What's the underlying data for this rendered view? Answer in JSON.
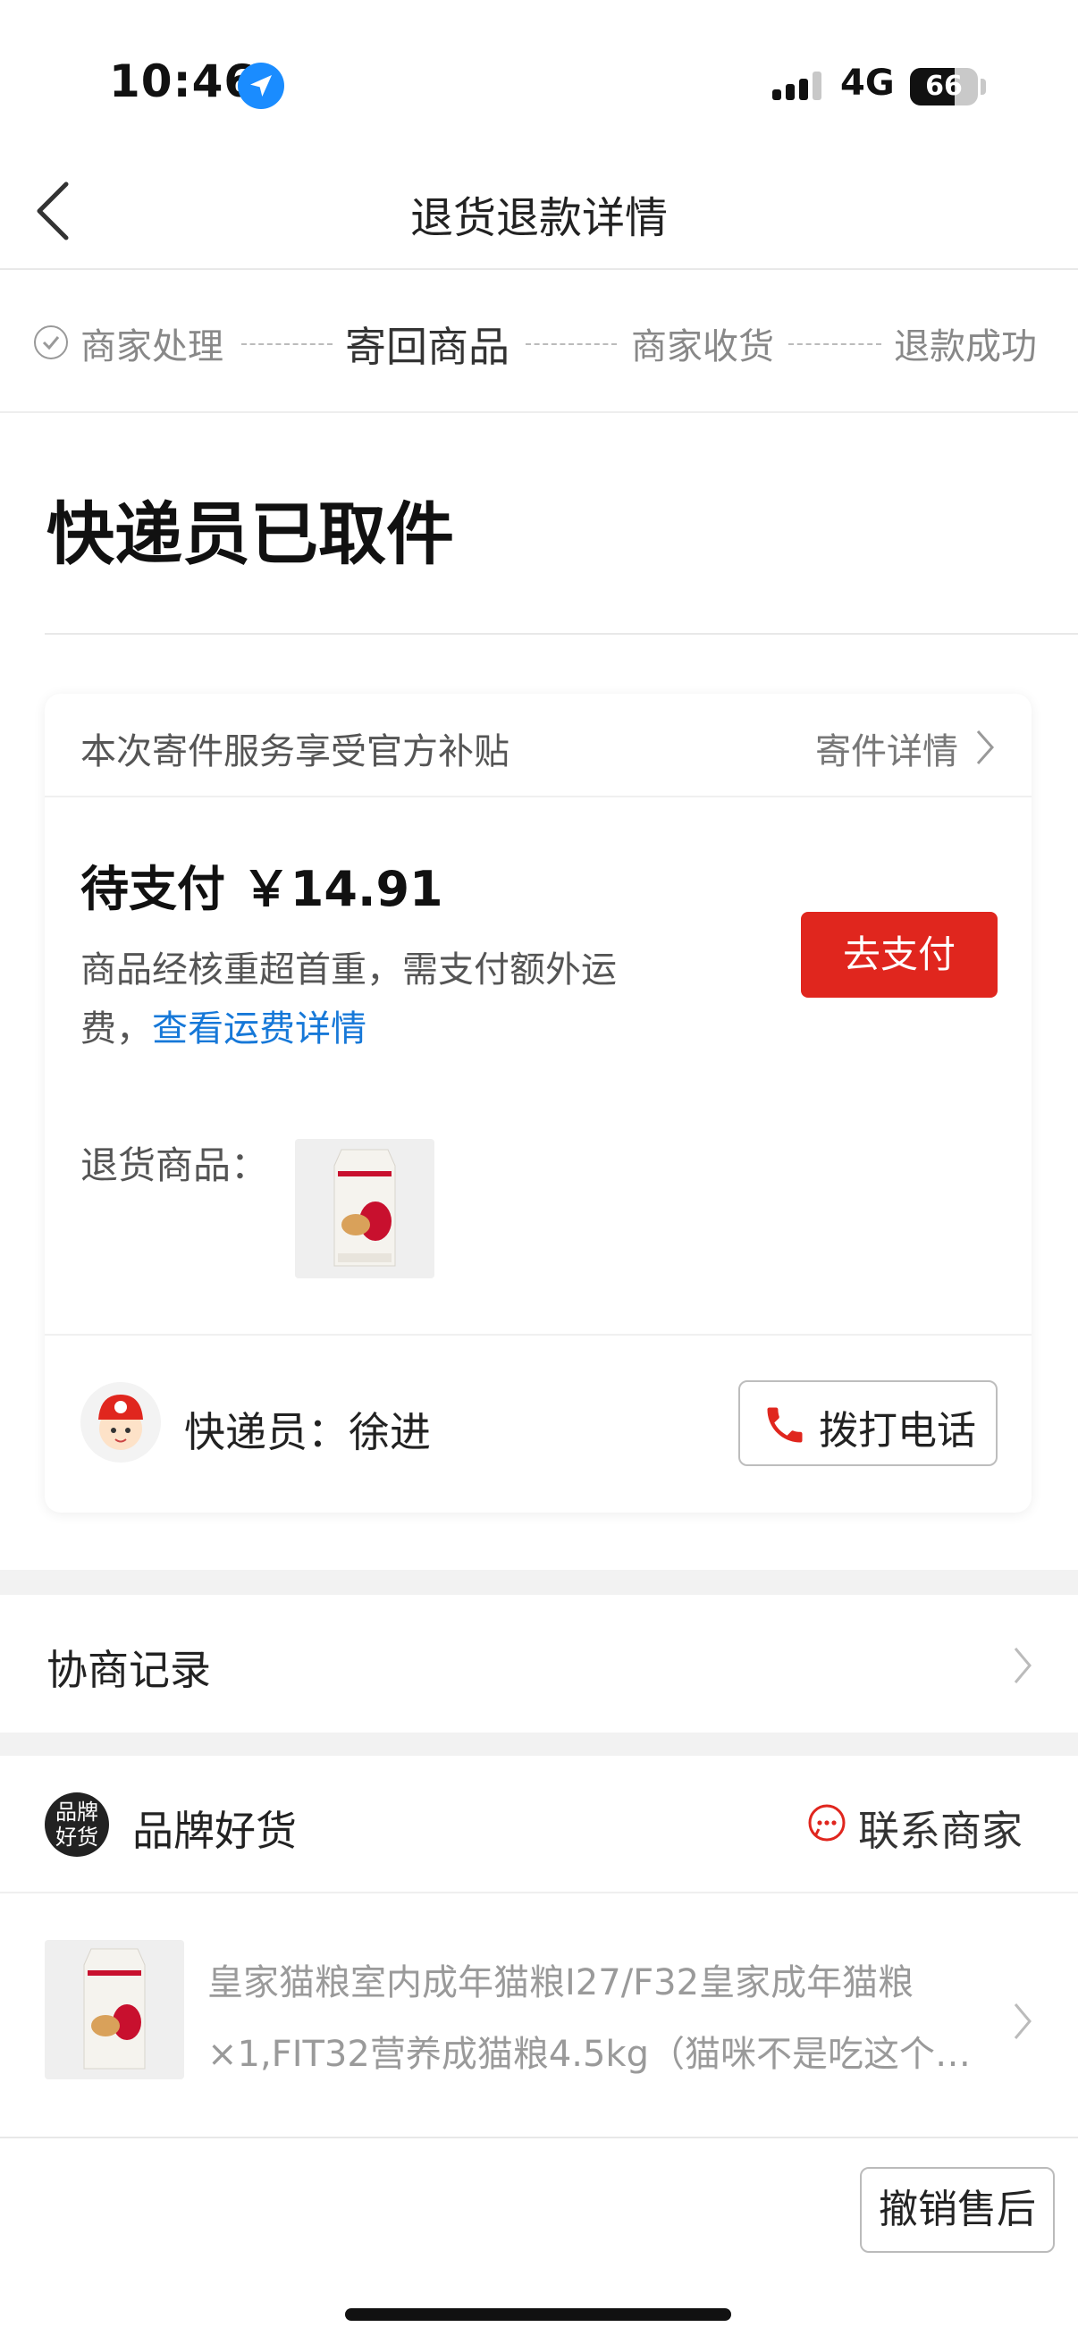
{
  "status_bar": {
    "time": "10:46",
    "network": "4G",
    "battery": "66"
  },
  "nav": {
    "title": "退货退款详情"
  },
  "steps": [
    {
      "label": "商家处理",
      "state": "done"
    },
    {
      "label": "寄回商品",
      "state": "active"
    },
    {
      "label": "商家收货",
      "state": "pending"
    },
    {
      "label": "退款成功",
      "state": "pending"
    }
  ],
  "status_title": "快递员已取件",
  "shipping_card": {
    "subsidy_text": "本次寄件服务享受官方补贴",
    "detail_link": "寄件详情",
    "pay_title": "待支付 ￥14.91",
    "pay_desc": "商品经核重超首重，需支付额外运费，",
    "pay_link": "查看运费详情",
    "pay_button": "去支付",
    "goods_label": "退货商品：",
    "courier_label": "快递员：徐进",
    "call_button": "拨打电话"
  },
  "negotiation": {
    "label": "协商记录"
  },
  "shop": {
    "badge": "品牌好货",
    "name": "品牌好货",
    "contact": "联系商家",
    "product_line1": "皇家猫粮室内成年猫粮I27/F32皇家成年猫粮",
    "product_line2": "×1,FIT32营养成猫粮4.5kg（猫咪不是吃这个…"
  },
  "footer": {
    "cancel_button": "撤销售后"
  },
  "colors": {
    "accent_red": "#e0261e",
    "link_blue": "#1678d8",
    "location_blue": "#1a8cff"
  }
}
